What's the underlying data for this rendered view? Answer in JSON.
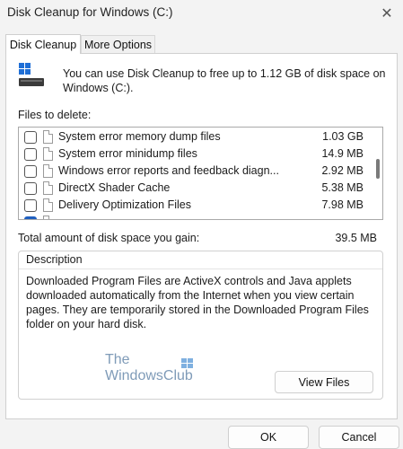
{
  "window": {
    "title": "Disk Cleanup for Windows (C:)",
    "close_glyph": "✕"
  },
  "tabs": [
    {
      "label": "Disk Cleanup"
    },
    {
      "label": "More Options"
    }
  ],
  "intro_text": "You can use Disk Cleanup to free up to 1.12 GB of disk space on Windows (C:).",
  "files_label": "Files to delete:",
  "files": [
    {
      "name": "System error memory dump files",
      "size": "1.03 GB",
      "checked": false
    },
    {
      "name": "System error minidump files",
      "size": "14.9 MB",
      "checked": false
    },
    {
      "name": "Windows error reports and feedback diagn...",
      "size": "2.92 MB",
      "checked": false
    },
    {
      "name": "DirectX Shader Cache",
      "size": "5.38 MB",
      "checked": false
    },
    {
      "name": "Delivery Optimization Files",
      "size": "7.98 MB",
      "checked": false
    }
  ],
  "total": {
    "label": "Total amount of disk space you gain:",
    "value": "39.5 MB"
  },
  "description": {
    "title": "Description",
    "text": "Downloaded Program Files are ActiveX controls and Java applets downloaded automatically from the Internet when you view certain pages. They are temporarily stored in the Downloaded Program Files folder on your hard disk."
  },
  "watermark": {
    "line1": "The",
    "line2": "WindowsClub"
  },
  "buttons": {
    "view_files": "View Files",
    "ok": "OK",
    "cancel": "Cancel"
  },
  "colors": {
    "accent": "#1f5fbf",
    "watermark": "#7f9bb8"
  }
}
